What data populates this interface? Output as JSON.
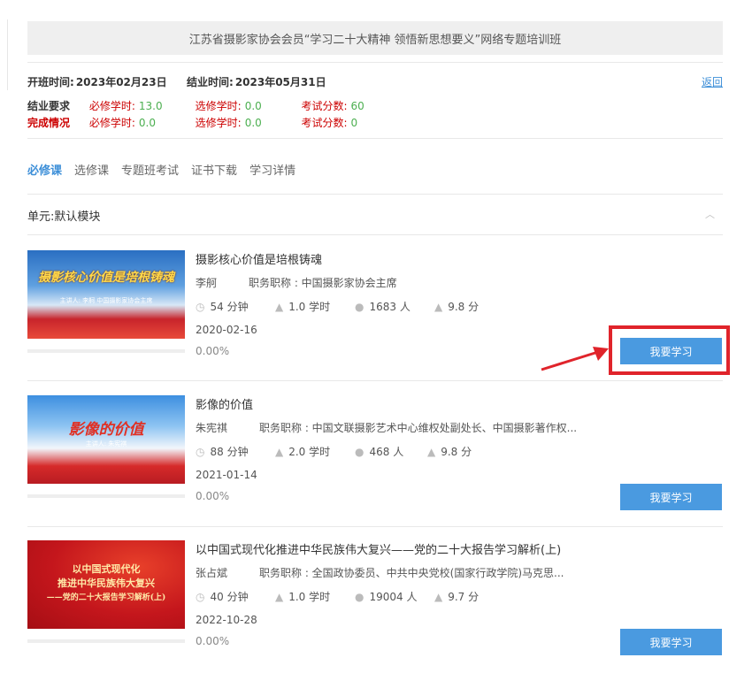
{
  "banner": {
    "title": "江苏省摄影家协会会员“学习二十大精神 领悟新思想要义”网络专题培训班"
  },
  "dates": {
    "start_label": "开班时间:",
    "start_value": "2023年02月23日",
    "end_label": "结业时间:",
    "end_value": "2023年05月31日"
  },
  "back_label": "返回",
  "requirements": {
    "label": "结业要求",
    "required_label": "必修学时:",
    "required_value": "13.0",
    "elective_label": "选修学时:",
    "elective_value": "0.0",
    "exam_label": "考试分数:",
    "exam_value": "60"
  },
  "completion": {
    "label": "完成情况",
    "required_label": "必修学时:",
    "required_value": "0.0",
    "elective_label": "选修学时:",
    "elective_value": "0.0",
    "exam_label": "考试分数:",
    "exam_value": "0"
  },
  "tabs": [
    "必修课",
    "选修课",
    "专题班考试",
    "证书下载",
    "学习详情"
  ],
  "active_tab": "必修课",
  "unit": {
    "label": "单元:默认模块"
  },
  "study_button_label": "我要学习",
  "courses": [
    {
      "title": "摄影核心价值是培根铸魂",
      "thumb_text": "摄影核心价值是培根铸魂",
      "thumb_sub": "主讲人: 李舸   中国摄影家协会主席",
      "author": "李舸",
      "role": "职务职称 : 中国摄影家协会主席",
      "duration": "54 分钟",
      "hours": "1.0 学时",
      "learners": "1683 人",
      "rating": "9.8 分",
      "date": "2020-02-16",
      "progress": "0.00%"
    },
    {
      "title": "影像的价值",
      "thumb_text": "影像的价值",
      "thumb_sub": "主讲人: 朱宪祺",
      "author": "朱宪祺",
      "role": "职务职称 : 中国文联摄影艺术中心维权处副处长、中国摄影著作权...",
      "duration": "88 分钟",
      "hours": "2.0 学时",
      "learners": "468 人",
      "rating": "9.8 分",
      "date": "2021-01-14",
      "progress": "0.00%"
    },
    {
      "title": "以中国式现代化推进中华民族伟大复兴——党的二十大报告学习解析(上)",
      "thumb_line1": "以中国式现代化",
      "thumb_line2": "推进中华民族伟大复兴",
      "thumb_line3": "——党的二十大报告学习解析(上)",
      "author": "张占斌",
      "role": "职务职称 : 全国政协委员、中共中央党校(国家行政学院)马克思...",
      "duration": "40 分钟",
      "hours": "1.0 学时",
      "learners": "19004 人",
      "rating": "9.7 分",
      "date": "2022-10-28",
      "progress": "0.00%"
    }
  ],
  "colors": {
    "accent": "#4a9ae0",
    "link": "#3d8fd8",
    "required_label": "#cc0000",
    "value_green": "#4caf50",
    "highlight": "#e0242b"
  },
  "icons": [
    "clock-icon",
    "graduation-cap-icon",
    "user-icon",
    "thumbs-up-icon",
    "chevron-up-icon",
    "arrow-annotation"
  ]
}
